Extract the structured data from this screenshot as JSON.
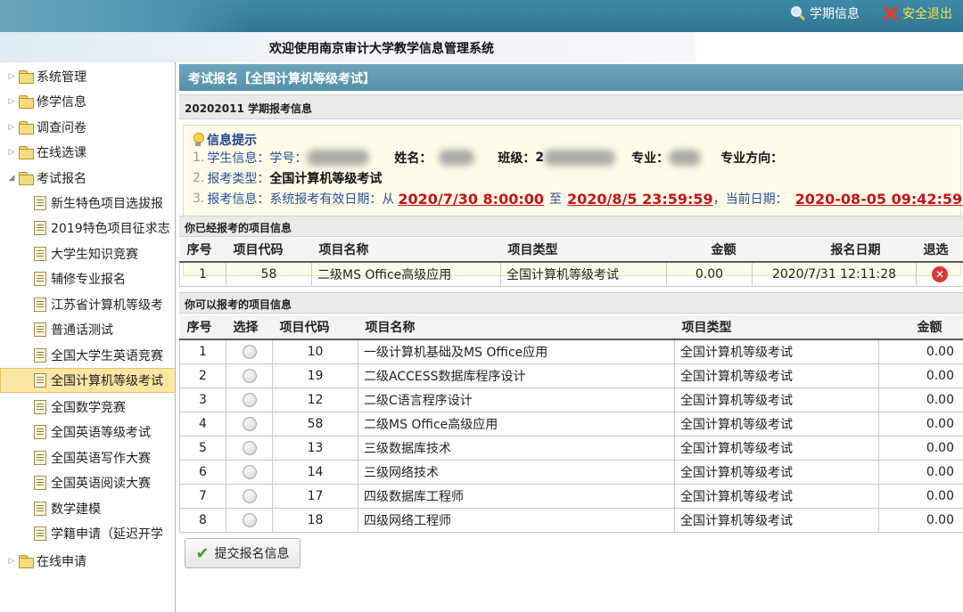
{
  "header": {
    "term_info_label": "学期信息",
    "logout_label": "安全退出",
    "welcome": "欢迎使用南京审计大学教学信息管理系统"
  },
  "sidebar": {
    "items": [
      {
        "label": "系统管理",
        "type": "folder"
      },
      {
        "label": "修学信息",
        "type": "folder"
      },
      {
        "label": "调查问卷",
        "type": "folder"
      },
      {
        "label": "在线选课",
        "type": "folder"
      },
      {
        "label": "考试报名",
        "type": "folder-open"
      },
      {
        "label": "新生特色项目选拔报",
        "type": "page"
      },
      {
        "label": "2019特色项目征求志",
        "type": "page"
      },
      {
        "label": "大学生知识竞赛",
        "type": "page"
      },
      {
        "label": "辅修专业报名",
        "type": "page"
      },
      {
        "label": "江苏省计算机等级考",
        "type": "page"
      },
      {
        "label": "普通话测试",
        "type": "page"
      },
      {
        "label": "全国大学生英语竞赛",
        "type": "page"
      },
      {
        "label": "全国计算机等级考试",
        "type": "page",
        "active": true
      },
      {
        "label": "全国数学竞赛",
        "type": "page"
      },
      {
        "label": "全国英语等级考试",
        "type": "page"
      },
      {
        "label": "全国英语写作大赛",
        "type": "page"
      },
      {
        "label": "全国英语阅读大赛",
        "type": "page"
      },
      {
        "label": "数学建模",
        "type": "page"
      },
      {
        "label": "学籍申请（延迟开学",
        "type": "page"
      },
      {
        "label": "在线申请",
        "type": "folder"
      }
    ]
  },
  "main": {
    "panel_title": "考试报名【全国计算机等级考试】",
    "term_header": "20202011 学期报考信息",
    "info": {
      "title": "信息提示",
      "line1": {
        "num": "1.",
        "label": "学生信息：",
        "sid_label": "学号：",
        "name_label": "姓名：",
        "class_label": "班级：",
        "class_prefix": "2",
        "major_label": "专业：",
        "direction_label": "专业方向："
      },
      "line2": {
        "num": "2.",
        "label": "报考类型：",
        "value": "全国计算机等级考试"
      },
      "line3": {
        "num": "3.",
        "label": "报考信息：",
        "text1": "系统报考有效日期：从",
        "start": "2020/7/30 8:00:00",
        "to": "至",
        "end": "2020/8/5 23:59:59",
        "text2": "，当前日期：",
        "now": "2020-08-05 09:42:59"
      }
    },
    "registered": {
      "title": "你已经报考的项目信息",
      "headers": [
        "序号",
        "项目代码",
        "项目名称",
        "项目类型",
        "金额",
        "报名日期",
        "退选"
      ],
      "rows": [
        {
          "no": "1",
          "code": "58",
          "name": "二级MS Office高级应用",
          "type": "全国计算机等级考试",
          "amount": "0.00",
          "date": "2020/7/31 12:11:28"
        }
      ]
    },
    "available": {
      "title": "你可以报考的项目信息",
      "headers": [
        "序号",
        "选择",
        "项目代码",
        "项目名称",
        "项目类型",
        "金额"
      ],
      "rows": [
        {
          "no": "1",
          "code": "10",
          "name": "一级计算机基础及MS Office应用",
          "type": "全国计算机等级考试",
          "amount": "0.00"
        },
        {
          "no": "2",
          "code": "19",
          "name": "二级ACCESS数据库程序设计",
          "type": "全国计算机等级考试",
          "amount": "0.00"
        },
        {
          "no": "3",
          "code": "12",
          "name": "二级C语言程序设计",
          "type": "全国计算机等级考试",
          "amount": "0.00"
        },
        {
          "no": "4",
          "code": "58",
          "name": "二级MS Office高级应用",
          "type": "全国计算机等级考试",
          "amount": "0.00"
        },
        {
          "no": "5",
          "code": "13",
          "name": "三级数据库技术",
          "type": "全国计算机等级考试",
          "amount": "0.00"
        },
        {
          "no": "6",
          "code": "14",
          "name": "三级网络技术",
          "type": "全国计算机等级考试",
          "amount": "0.00"
        },
        {
          "no": "7",
          "code": "17",
          "name": "四级数据库工程师",
          "type": "全国计算机等级考试",
          "amount": "0.00"
        },
        {
          "no": "8",
          "code": "18",
          "name": "四级网络工程师",
          "type": "全国计算机等级考试",
          "amount": "0.00"
        }
      ]
    },
    "submit_label": "提交报名信息"
  }
}
